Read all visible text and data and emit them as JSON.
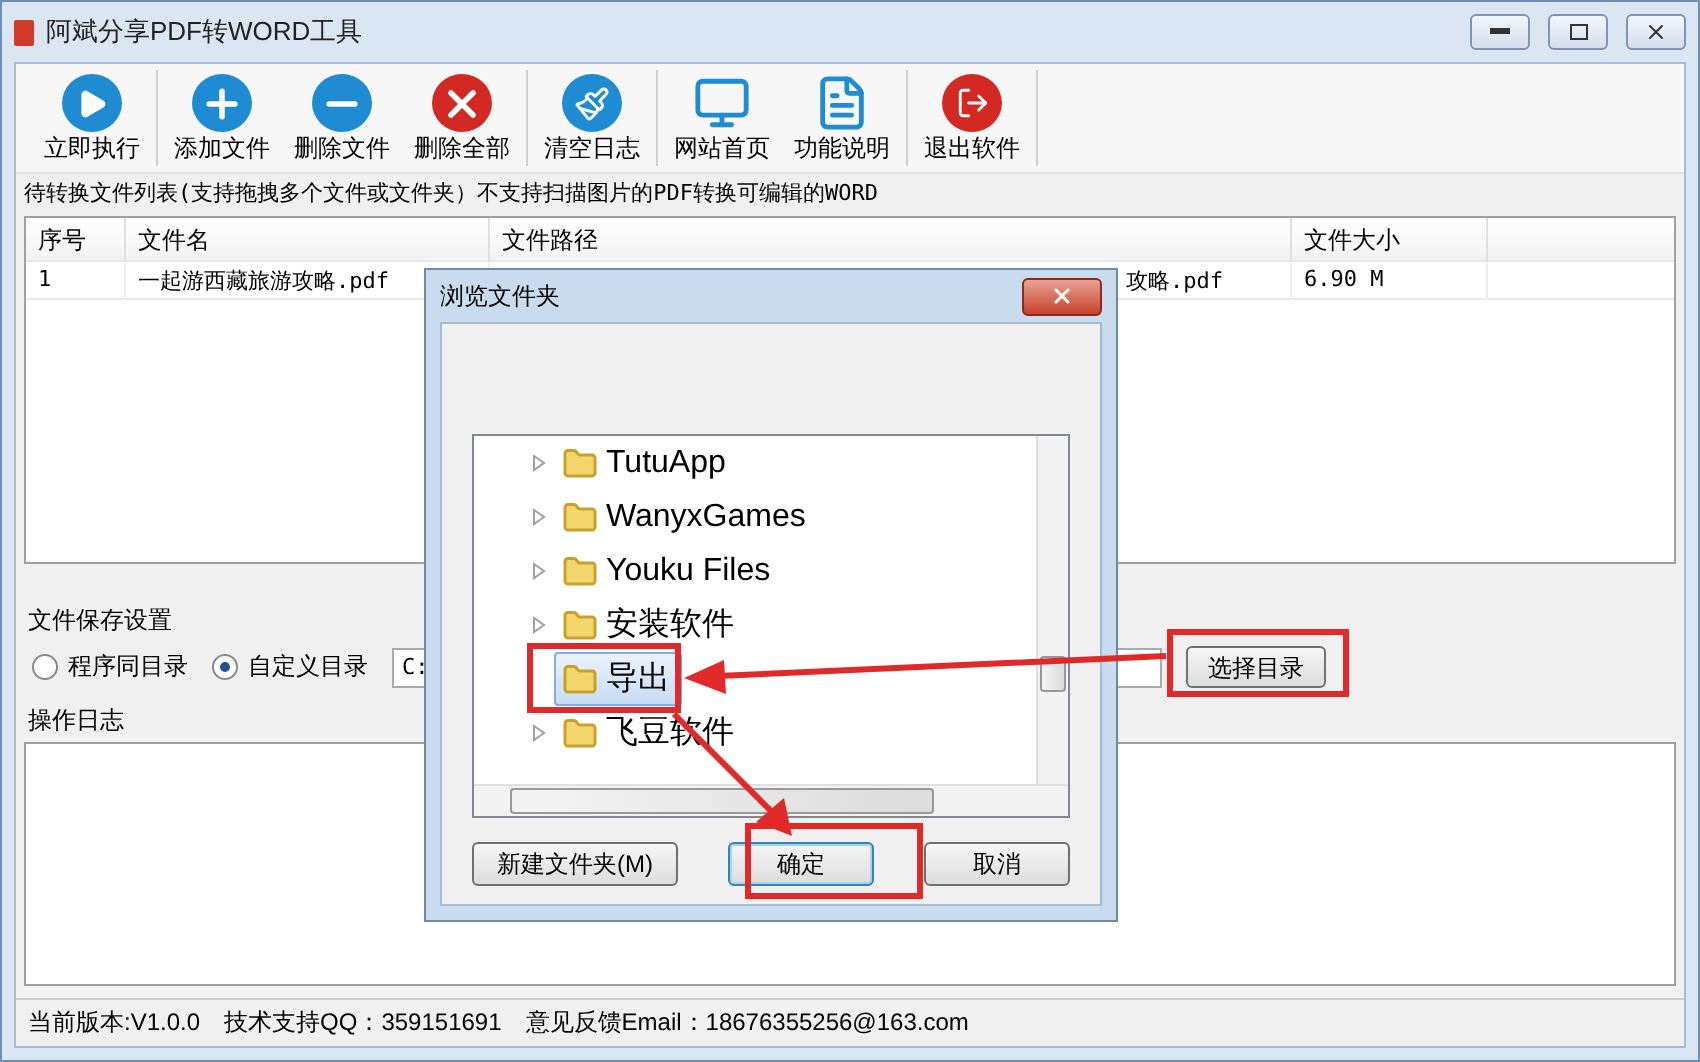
{
  "window": {
    "title": "阿斌分享PDF转WORD工具"
  },
  "toolbar": [
    [
      {
        "label": "立即执行",
        "kind": "play"
      }
    ],
    [
      {
        "label": "添加文件",
        "kind": "add"
      },
      {
        "label": "删除文件",
        "kind": "remove"
      },
      {
        "label": "删除全部",
        "kind": "clear"
      }
    ],
    [
      {
        "label": "清空日志",
        "kind": "broom"
      }
    ],
    [
      {
        "label": "网站首页",
        "kind": "monitor"
      },
      {
        "label": "功能说明",
        "kind": "doc"
      }
    ],
    [
      {
        "label": "退出软件",
        "kind": "exit"
      }
    ]
  ],
  "file_list": {
    "caption": "待转换文件列表(支持拖拽多个文件或文件夹）不支持扫描图片的PDF转换可编辑的WORD",
    "columns": [
      "序号",
      "文件名",
      "文件路径",
      "文件大小"
    ],
    "rows": [
      [
        "1",
        "一起游西藏旅游攻略.pdf",
        "攻略.pdf",
        "6.90 M"
      ]
    ]
  },
  "save_settings": {
    "label": "文件保存设置",
    "options": [
      {
        "label": "程序同目录",
        "selected": false
      },
      {
        "label": "自定义目录",
        "selected": true
      }
    ],
    "path": "C:",
    "button": "选择目录"
  },
  "log": {
    "label": "操作日志"
  },
  "status_bar": [
    "当前版本:V1.0.0",
    "技术支持QQ：359151691",
    "意见反馈Email：18676355256@163.com"
  ],
  "dialog": {
    "title": "浏览文件夹",
    "folders": [
      {
        "label": "TutuApp",
        "expandable": true,
        "selected": false
      },
      {
        "label": "WanyxGames",
        "expandable": true,
        "selected": false
      },
      {
        "label": "Youku Files",
        "expandable": true,
        "selected": false
      },
      {
        "label": "安装软件",
        "expandable": true,
        "selected": false
      },
      {
        "label": "导出",
        "expandable": false,
        "selected": true
      },
      {
        "label": "飞豆软件",
        "expandable": true,
        "selected": false
      }
    ],
    "buttons": [
      {
        "label": "新建文件夹(M)",
        "default": false
      },
      {
        "label": "确定",
        "default": true
      },
      {
        "label": "取消",
        "default": false
      }
    ]
  }
}
